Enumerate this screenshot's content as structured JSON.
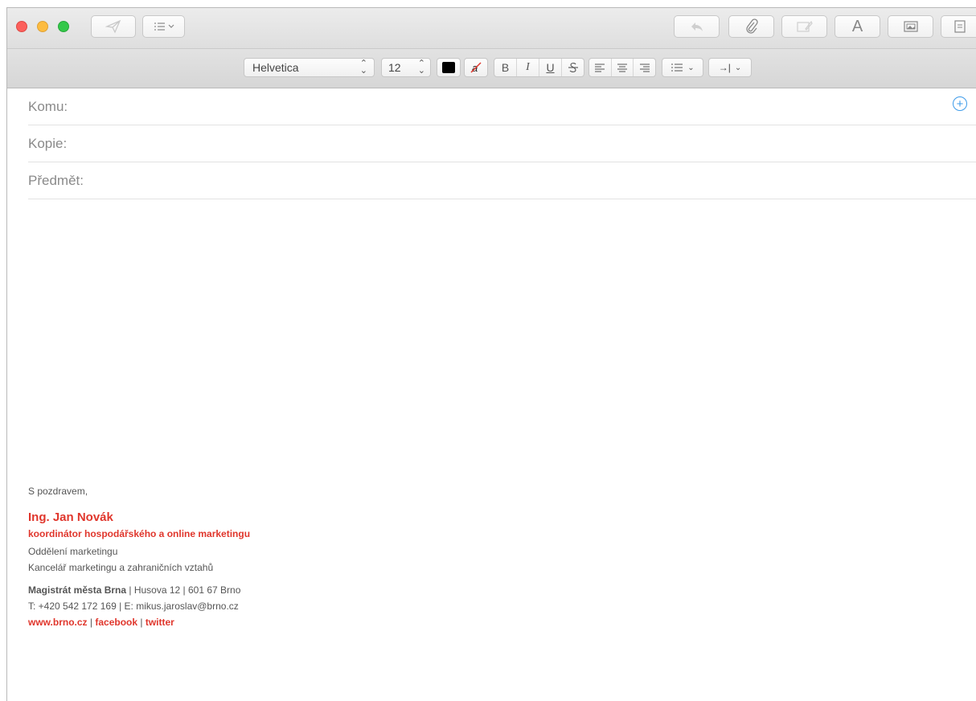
{
  "formatting": {
    "font": "Helvetica",
    "size": "12",
    "text_color": "#000000",
    "bold": "B",
    "italic": "I",
    "underline": "U",
    "indent_label": "→|"
  },
  "headers": {
    "to_label": "Komu:",
    "cc_label": "Kopie:",
    "subject_label": "Předmět:"
  },
  "signature": {
    "greeting": "S pozdravem,",
    "name": "Ing. Jan Novák",
    "role": "koordinátor hospodářského a online marketingu",
    "department": "Oddělení marketingu",
    "office": "Kancelář marketingu a zahraničních vztahů",
    "org_name": "Magistrát města Brna",
    "org_address": " | Husova 12 | 601 67 Brno",
    "contact": "T: +420 542 172 169 | E: mikus.jaroslav@brno.cz",
    "link_web": "www.brno.cz",
    "separator": " | ",
    "link_facebook": "facebook",
    "link_twitter": "twitter"
  },
  "colors": {
    "accent_red": "#e0362c",
    "add_contact_blue": "#3d9be9"
  }
}
